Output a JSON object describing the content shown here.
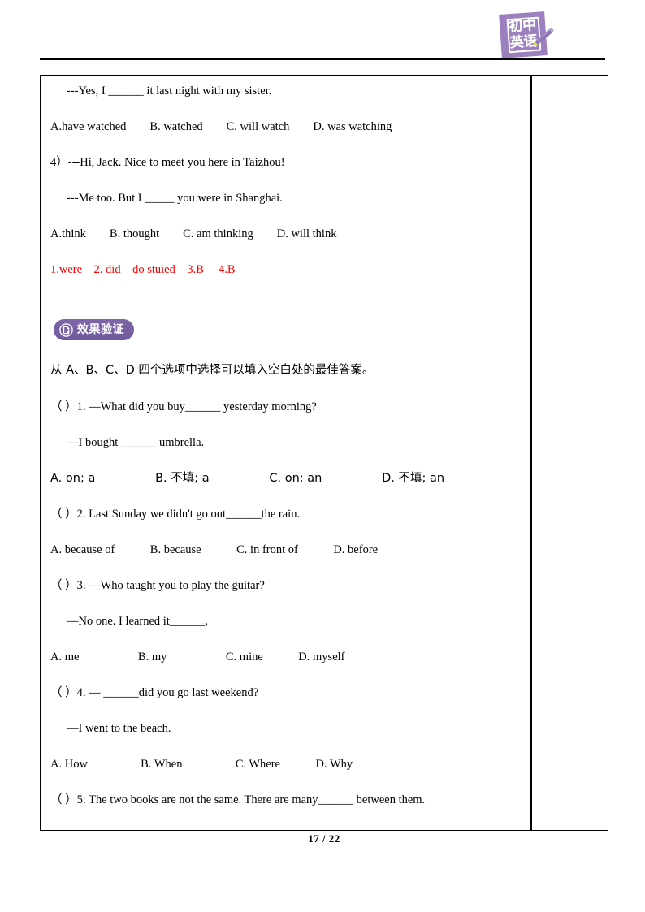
{
  "header": {
    "logo": {
      "line1": "初中",
      "line2": "英语",
      "bg_color": "#9b7fbe",
      "pencil_icon": "pencil-icon"
    }
  },
  "document": {
    "top_exercise": {
      "q3_answer_line": "---Yes, I ______ it last night with my sister.",
      "q3_options": "A.have watched        B. watched        C. will watch        D. was watching",
      "q4_prompt": "4）---Hi, Jack. Nice to meet you here in Taizhou!",
      "q4_answer_line": "---Me too. But I _____ you were in Shanghai.",
      "q4_options": "A.think        B. thought        C. am thinking        D. will think",
      "answer_key": "1.were    2. did    do stuied    3.B     4.B",
      "answer_key_color": "#ff0000"
    },
    "section": {
      "badge_label": "效果验证",
      "badge_icon": "document-check-circle-icon",
      "badge_color": "#6f589c",
      "instruction": "从 A、B、C、D 四个选项中选择可以填入空白处的最佳答案。"
    },
    "questions": [
      {
        "stem": "（ ）1. —What did you buy______ yesterday morning?",
        "reply": "—I bought ______ umbrella.",
        "options": "A. on; a                B. 不填; a                C. on; an                D. 不填; an"
      },
      {
        "stem": "（ ）2. Last Sunday we didn't go out______the rain.",
        "reply": "",
        "options": "A. because of            B. because            C. in front of            D. before"
      },
      {
        "stem": "（ ）3. —Who taught you to play the guitar?",
        "reply": "—No one. I learned it______.",
        "options": "A. me                    B. my                    C. mine            D. myself"
      },
      {
        "stem": "（ ）4. — ______did you go last weekend?",
        "reply": "—I went to the beach.",
        "options": "A. How                  B. When                  C. Where            D. Why"
      },
      {
        "stem": "（ ）5. The two books are not the same. There are many______ between them.",
        "reply": "",
        "options": ""
      }
    ]
  },
  "footer": {
    "page_number": "17 / 22"
  }
}
